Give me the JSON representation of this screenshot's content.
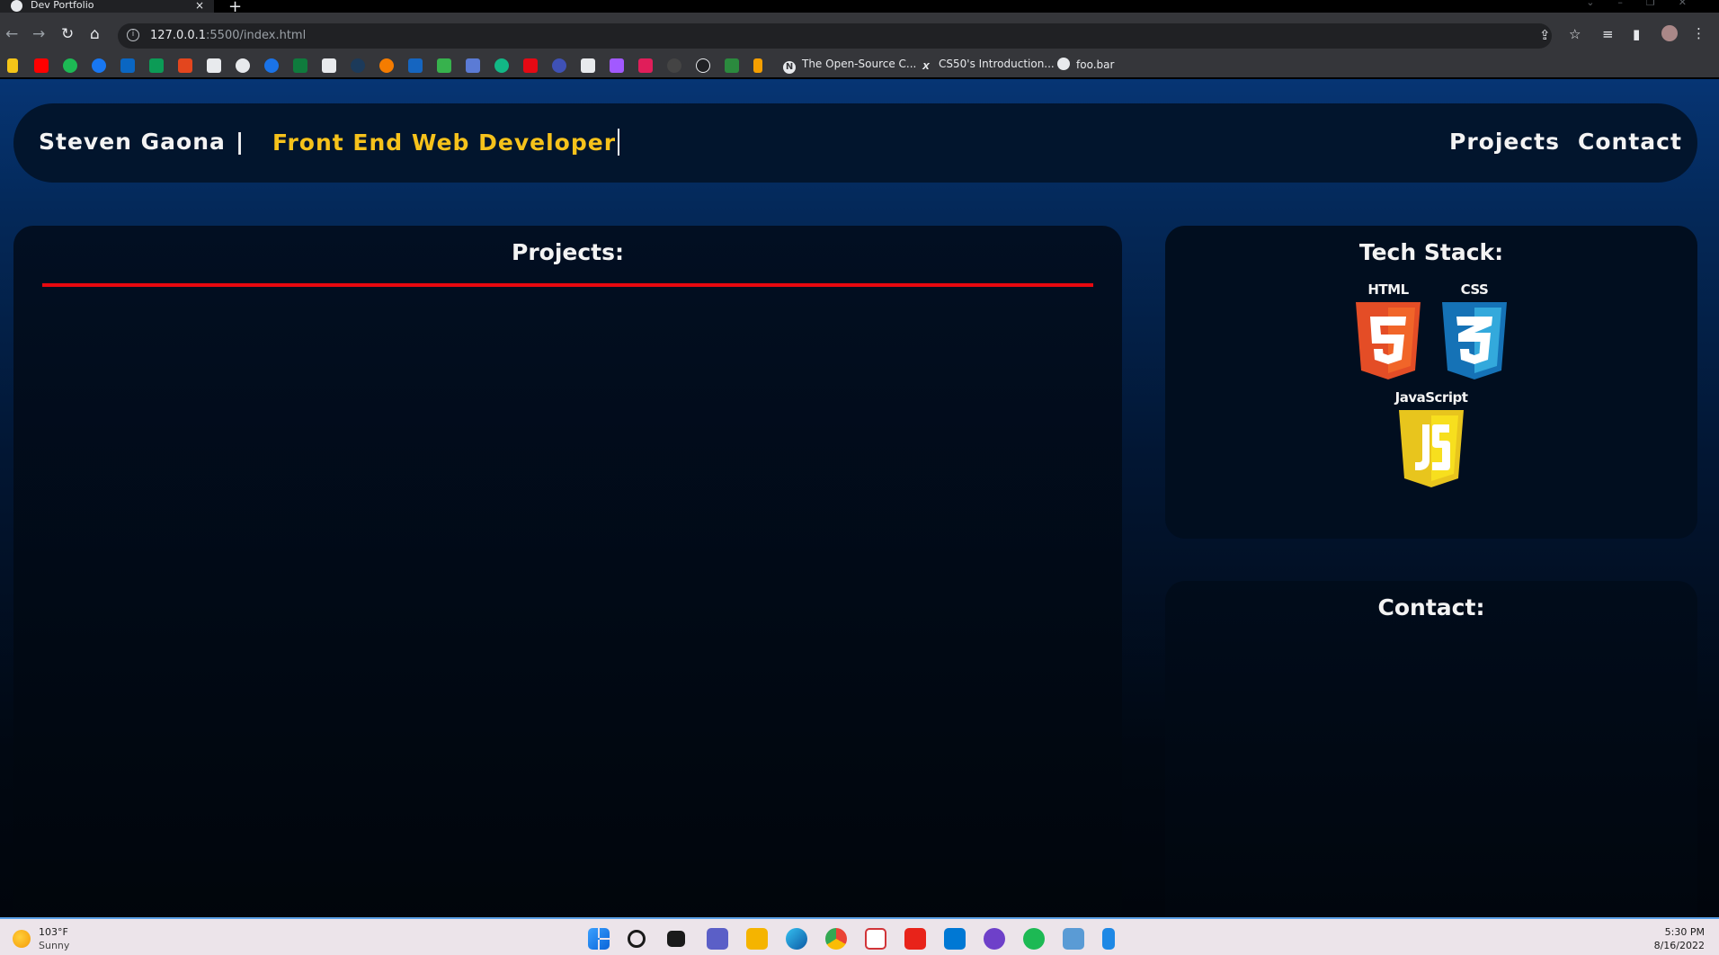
{
  "browser": {
    "tab_title": "Dev Portfolio",
    "new_tab": "+",
    "close_tab": "×",
    "url_host": "127.0.0.1",
    "url_rest": ":5500/index.html",
    "bookmarks": [
      "The Open-Source C...",
      "CS50's Introduction...",
      "foo.bar"
    ]
  },
  "nav": {
    "name": "Steven Gaona",
    "separator": "|",
    "role": "Front End Web Developer",
    "links": [
      "Projects",
      "Contact"
    ]
  },
  "projects": {
    "heading": "Projects:"
  },
  "tech_stack": {
    "heading": "Tech Stack:",
    "items": [
      {
        "label": "HTML",
        "icon": "html5-icon",
        "color": "#e44d26"
      },
      {
        "label": "CSS",
        "icon": "css3-icon",
        "color": "#2965f1"
      },
      {
        "label": "JavaScript",
        "icon": "javascript-icon",
        "color": "#f0db4f"
      }
    ]
  },
  "contact": {
    "heading": "Contact:"
  },
  "taskbar": {
    "weather_temp": "103°F",
    "weather_condition": "Sunny",
    "time": "5:30 PM",
    "date": "8/16/2022"
  },
  "colors": {
    "accent_yellow": "#f6c21b",
    "rule_red": "#e8080f",
    "panel_bg": "#010b1a"
  }
}
